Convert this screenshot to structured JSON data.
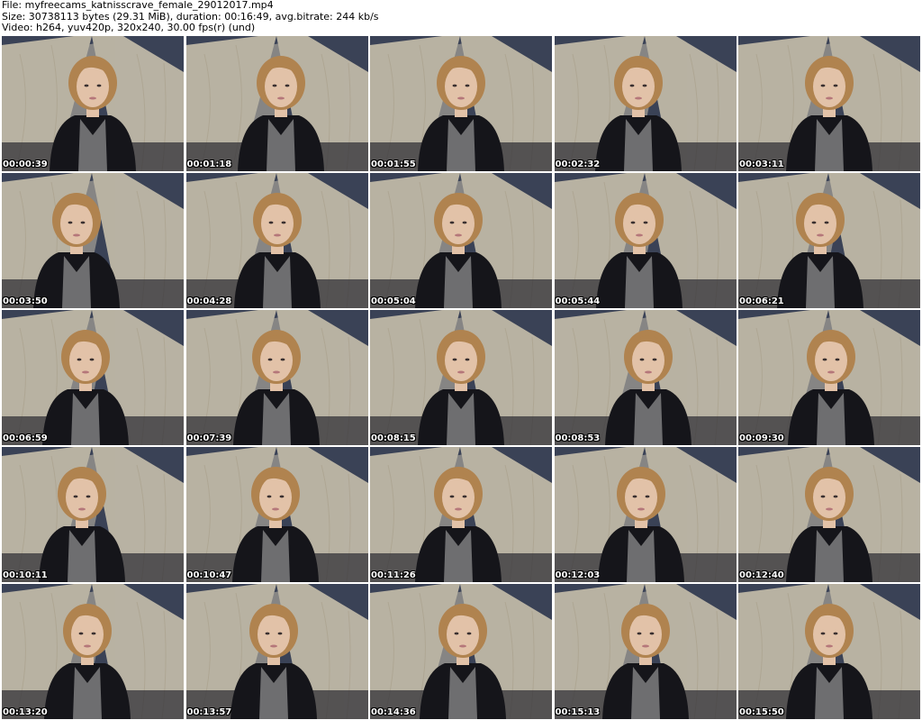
{
  "header": {
    "line1": "File: myfreecams_katnisscrave_female_29012017.mp4",
    "line2": "Size: 30738113 bytes (29.31 MiB), duration: 00:16:49, avg.bitrate: 244 kb/s",
    "line3": "Video: h264, yuv420p, 320x240, 30.00 fps(r) (und)"
  },
  "colors": {
    "wall": "#3a4256",
    "curtain": "#cfc6b0",
    "hair": "#b0834f",
    "skin": "#e2c2a8",
    "jacket": "#15151a",
    "shirt": "#6e6e70",
    "timestamp_text": "#ffffff"
  },
  "thumbnails": [
    {
      "time": "00:00:39",
      "offset": 0
    },
    {
      "time": "00:01:18",
      "offset": 4
    },
    {
      "time": "00:01:55",
      "offset": 0
    },
    {
      "time": "00:02:32",
      "offset": -8
    },
    {
      "time": "00:03:11",
      "offset": 0
    },
    {
      "time": "00:03:50",
      "offset": -18
    },
    {
      "time": "00:04:28",
      "offset": 0
    },
    {
      "time": "00:05:04",
      "offset": -3
    },
    {
      "time": "00:05:44",
      "offset": -7
    },
    {
      "time": "00:06:21",
      "offset": -10
    },
    {
      "time": "00:06:59",
      "offset": -8
    },
    {
      "time": "00:07:39",
      "offset": -1
    },
    {
      "time": "00:08:15",
      "offset": 0
    },
    {
      "time": "00:08:53",
      "offset": 3
    },
    {
      "time": "00:09:30",
      "offset": 2
    },
    {
      "time": "00:10:11",
      "offset": -12
    },
    {
      "time": "00:10:47",
      "offset": -2
    },
    {
      "time": "00:11:26",
      "offset": -3
    },
    {
      "time": "00:12:03",
      "offset": -5
    },
    {
      "time": "00:12:40",
      "offset": 0
    },
    {
      "time": "00:13:20",
      "offset": -6
    },
    {
      "time": "00:13:57",
      "offset": -4
    },
    {
      "time": "00:14:36",
      "offset": 2
    },
    {
      "time": "00:15:13",
      "offset": 0
    },
    {
      "time": "00:15:50",
      "offset": 0
    }
  ]
}
